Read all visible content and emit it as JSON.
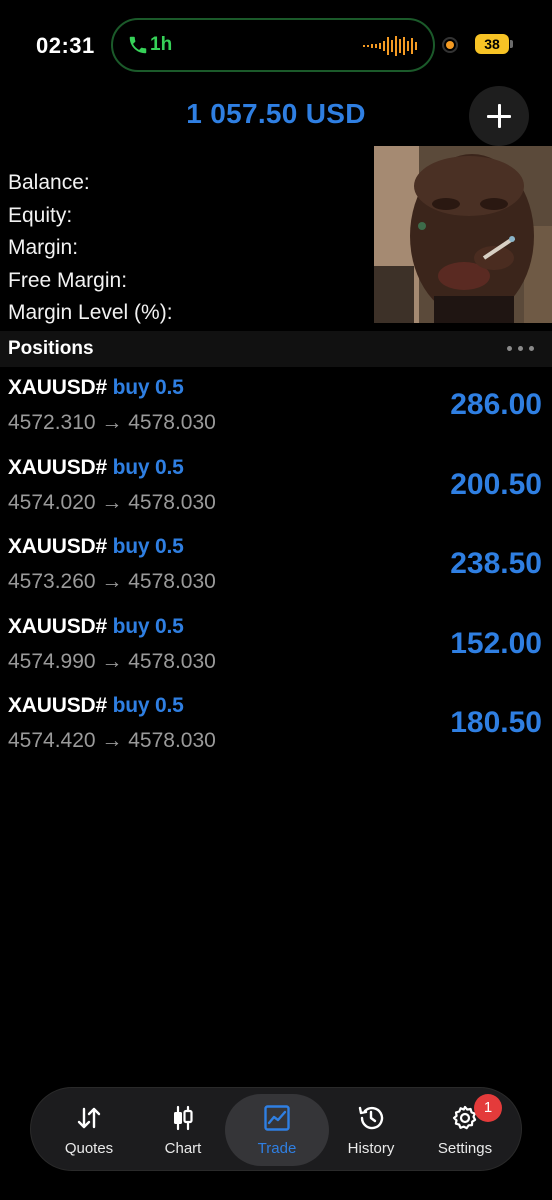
{
  "status_bar": {
    "time": "02:31",
    "call_duration": "1h",
    "battery": "38",
    "colors": {
      "call": "#36d158",
      "battery": "#f7c325",
      "recording": "#f59b23"
    }
  },
  "header": {
    "balance_title": "1 057.50 USD",
    "add_icon": "plus-icon"
  },
  "summary": {
    "labels": [
      "Balance:",
      "Equity:",
      "Margin:",
      "Free Margin:",
      "Margin Level (%):"
    ]
  },
  "positions": {
    "title": "Positions",
    "more_icon": "ellipsis-icon",
    "items": [
      {
        "symbol": "XAUUSD#",
        "side": "buy 0.5",
        "prices": "4572.310 → 4578.030",
        "profit": "286.00"
      },
      {
        "symbol": "XAUUSD#",
        "side": "buy 0.5",
        "prices": "4574.020 → 4578.030",
        "profit": "200.50"
      },
      {
        "symbol": "XAUUSD#",
        "side": "buy 0.5",
        "prices": "4573.260 → 4578.030",
        "profit": "238.50"
      },
      {
        "symbol": "XAUUSD#",
        "side": "buy 0.5",
        "prices": "4574.990 → 4578.030",
        "profit": "152.00"
      },
      {
        "symbol": "XAUUSD#",
        "side": "buy 0.5",
        "prices": "4574.420 → 4578.030",
        "profit": "180.50"
      }
    ]
  },
  "tabbar": {
    "tabs": [
      {
        "label": "Quotes",
        "icon": "arrows-updown-icon"
      },
      {
        "label": "Chart",
        "icon": "candlestick-icon"
      },
      {
        "label": "Trade",
        "icon": "trade-chart-icon",
        "active": true
      },
      {
        "label": "History",
        "icon": "history-icon"
      },
      {
        "label": "Settings",
        "icon": "gear-icon"
      }
    ],
    "settings_badge": "1"
  },
  "colors": {
    "accent": "#2f7fe2",
    "background": "#000000",
    "badge": "#e43b3b"
  }
}
